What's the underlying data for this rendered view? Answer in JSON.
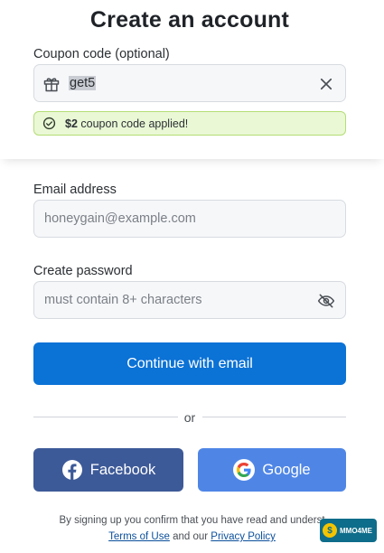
{
  "header": {
    "title": "Create an account"
  },
  "coupon": {
    "label": "Coupon code (optional)",
    "value": "get5",
    "success": {
      "amount": "$2",
      "message": "coupon code applied!"
    }
  },
  "email": {
    "label": "Email address",
    "placeholder": "honeygain@example.com"
  },
  "password": {
    "label": "Create password",
    "placeholder": "must contain 8+ characters"
  },
  "actions": {
    "continue_label": "Continue with email",
    "divider_text": "or",
    "facebook_label": "Facebook",
    "google_label": "Google"
  },
  "legal": {
    "line1": "By signing up you confirm that you have read and underst",
    "terms_link": "Terms of Use",
    "and_our": "and our",
    "privacy_link": "Privacy Policy"
  },
  "watermark": {
    "text": "MMO4ME"
  },
  "colors": {
    "primary": "#0b72d6",
    "facebook": "#3d5a98",
    "google": "#4f86e6",
    "success_bg": "#eaf8d6",
    "success_border": "#b4dd75"
  }
}
